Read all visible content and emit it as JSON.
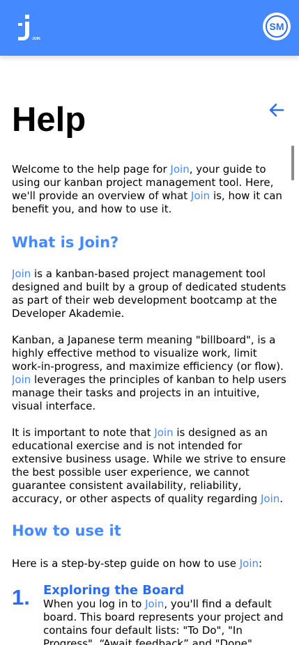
{
  "header": {
    "logo_icon": "join-logo-icon",
    "logo_text": "JOIN",
    "user_initials": "SM"
  },
  "page": {
    "title": "Help",
    "back_icon": "arrow-left-icon"
  },
  "intro": {
    "before": "Welcome to the help page for ",
    "brand1": "Join",
    "middle": ", your guide to using our kanban project management tool. Here, we'll provide an overview of what ",
    "brand2": "Join",
    "after": " is, how it can benefit you, and how to use it."
  },
  "what": {
    "heading": "What is Join?",
    "p1": {
      "brand": "Join",
      "text": " is a kanban-based project management tool designed and built by a group of dedicated students as part of their web development bootcamp at the Developer Akademie."
    },
    "p2": {
      "before": "Kanban, a Japanese term meaning \"billboard\", is a highly effective method to visualize work, limit work-in-progress, and maximize efficiency (or flow). ",
      "brand": "Join",
      "after": " leverages the principles of kanban to help users manage their tasks and projects in an intuitive, visual interface."
    },
    "p3": {
      "before": "It is important to note that ",
      "brand1": "Join",
      "middle": " is designed as an educational exercise and is not intended for extensive business usage. While we strive to ensure the best possible user experience, we cannot guarantee consistent availability, reliability, accuracy, or other aspects of quality regarding ",
      "brand2": "Join",
      "after": "."
    }
  },
  "how": {
    "heading": "How to use it",
    "intro_before": "Here is a step-by-step guide on how to use ",
    "intro_brand": "Join",
    "intro_after": ":",
    "steps": [
      {
        "number": "1.",
        "title": "Exploring the Board",
        "before": "When you log in to ",
        "brand": "Join",
        "after": ", you'll find a default board. This board represents your project and contains four default lists: \"To Do\", \"In Progress\", “Await feedback” and \"Done\"."
      }
    ]
  },
  "colors": {
    "header_bg": "#4589ff",
    "accent": "#4589ff",
    "step_accent": "#2a6df4"
  }
}
